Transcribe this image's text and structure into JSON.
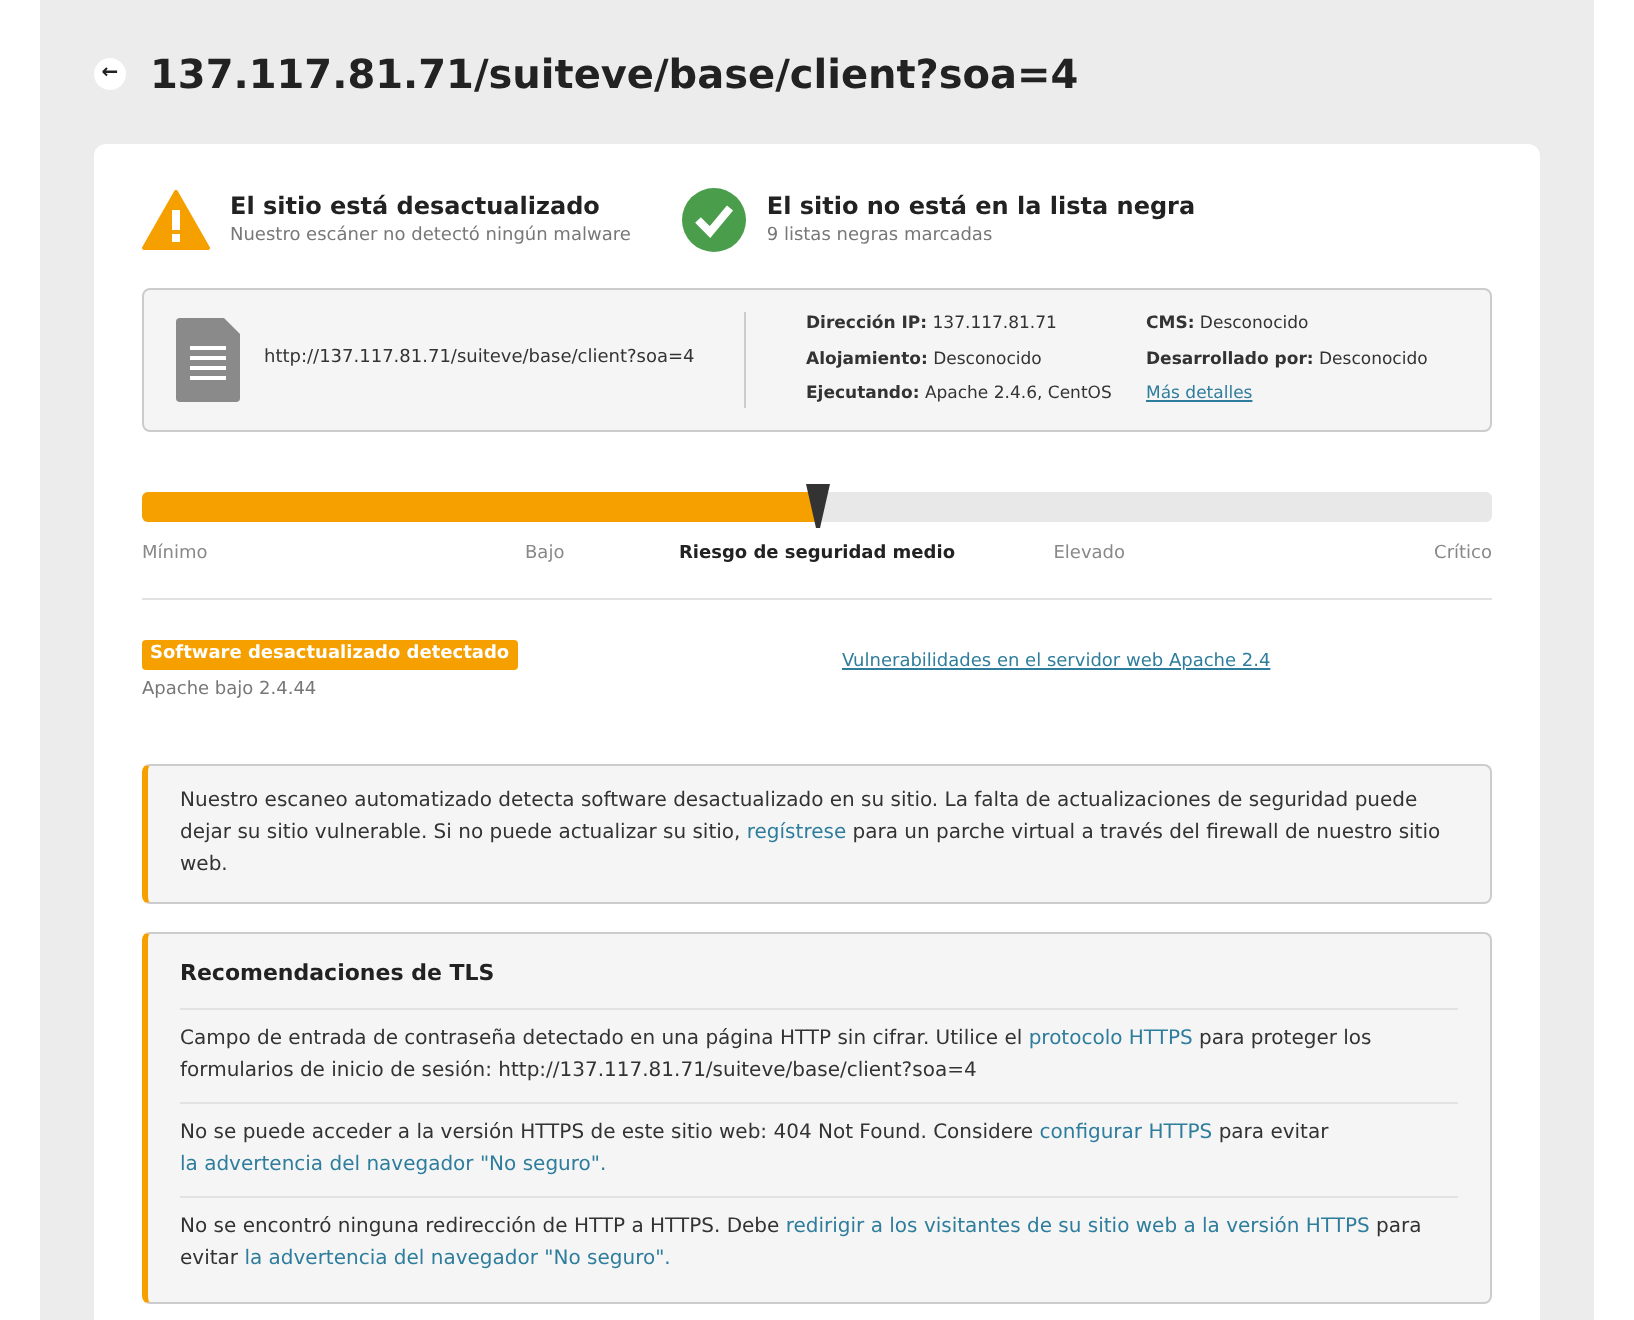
{
  "header": {
    "back": "←",
    "title": "137.117.81.71/suiteve/base/client?soa=4"
  },
  "status": [
    {
      "kind": "warning",
      "title": "El sitio está desactualizado",
      "subtitle": "Nuestro escáner no detectó ningún malware"
    },
    {
      "kind": "ok",
      "title": "El sitio no está en la lista negra",
      "subtitle": "9 listas negras marcadas"
    }
  ],
  "site": {
    "url": "http://137.117.81.71/suiteve/base/client?soa=4",
    "details": [
      {
        "label": "Dirección IP:",
        "value": "137.117.81.71"
      },
      {
        "label": "Alojamiento:",
        "value": "Desconocido"
      },
      {
        "label": "Ejecutando:",
        "value": "Apache 2.4.6, CentOS"
      }
    ],
    "details_2": [
      {
        "label": "CMS:",
        "value": "Desconocido"
      },
      {
        "label": "Desarrollado por:",
        "value": "Desconocido"
      }
    ],
    "more_link": "Más detalles"
  },
  "risk": {
    "level": 0.5,
    "labels": [
      {
        "text": "Mínimo",
        "selected": false
      },
      {
        "text": "Bajo",
        "selected": false
      },
      {
        "text": "Riesgo de seguridad medio",
        "selected": true
      },
      {
        "text": "Elevado",
        "selected": false
      },
      {
        "text": "Crítico",
        "selected": false
      }
    ]
  },
  "finding": {
    "badge": "Software desactualizado detectado",
    "detail": "Apache bajo 2.4.44",
    "link": "Vulnerabilidades en el servidor web Apache 2.4"
  },
  "notice": [
    {
      "kind": "text",
      "text": "Nuestro escaneo automatizado detecta software desactualizado en su sitio. La falta de actualizaciones de seguridad puede dejar su sitio vulnerable. Si no puede actualizar su sitio, "
    },
    {
      "kind": "link",
      "text": "regístrese"
    },
    {
      "kind": "text",
      "text": " para un parche virtual a través del firewall de nuestro sitio web."
    }
  ],
  "tls": {
    "title": "Recomendaciones de TLS",
    "items": [
      [
        {
          "kind": "text",
          "text": "Campo de entrada de contraseña detectado en una página HTTP sin cifrar. Utilice el "
        },
        {
          "kind": "link",
          "text": "protocolo HTTPS"
        },
        {
          "kind": "text",
          "text": " para proteger los formularios de inicio de sesión: http://137.117.81.71/suiteve/base/client?soa=4"
        }
      ],
      [
        {
          "kind": "text",
          "text": "No se puede acceder a la versión HTTPS de este sitio web: 404 Not Found. Considere "
        },
        {
          "kind": "link",
          "text": "configurar HTTPS"
        },
        {
          "kind": "text",
          "text": " para evitar "
        },
        {
          "kind": "link",
          "text": "la advertencia del navegador \"No seguro\"."
        }
      ],
      [
        {
          "kind": "text",
          "text": "No se encontró ninguna redirección de HTTP a HTTPS. Debe "
        },
        {
          "kind": "link",
          "text": "redirigir a los visitantes de su sitio web a la versión HTTPS"
        },
        {
          "kind": "text",
          "text": " para evitar "
        },
        {
          "kind": "link",
          "text": "la advertencia del navegador \"No seguro\"."
        }
      ]
    ]
  }
}
